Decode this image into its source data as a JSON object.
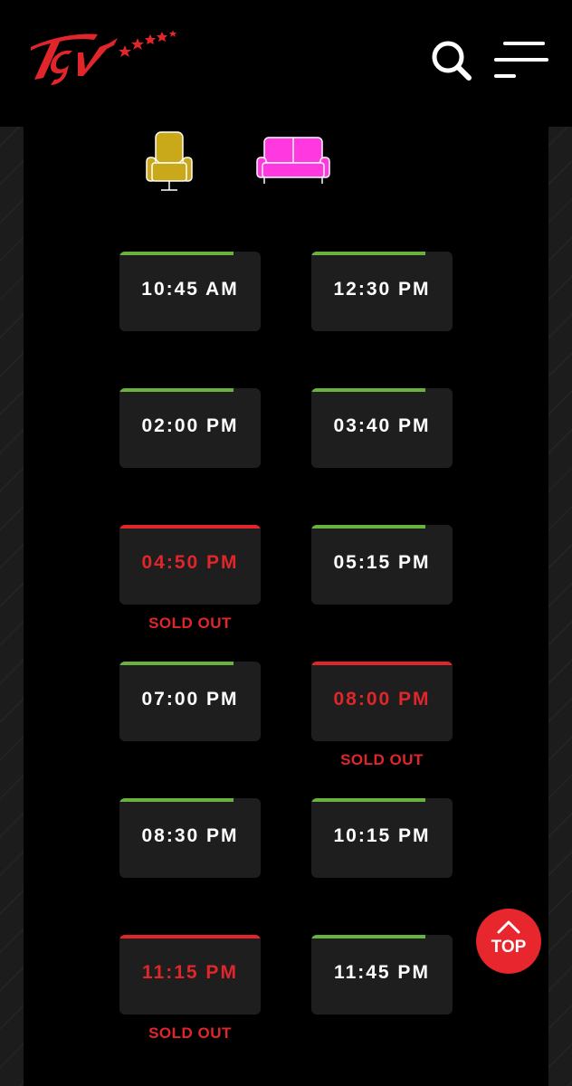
{
  "header": {
    "logo_text": "Tgv",
    "search_icon": "search-icon",
    "menu_icon": "hamburger-menu-icon"
  },
  "colors": {
    "accent_red": "#e0262b",
    "available_green": "#6ab23e",
    "single_seat": "#c9a81a",
    "couple_seat": "#ff38e0"
  },
  "legend": {
    "single_seat_icon": "single-seat-icon",
    "couple_seat_icon": "couple-seat-icon"
  },
  "showtimes": [
    {
      "time": "10:45 AM",
      "status": "available",
      "status_label": ""
    },
    {
      "time": "12:30 PM",
      "status": "available",
      "status_label": ""
    },
    {
      "time": "02:00 PM",
      "status": "available",
      "status_label": ""
    },
    {
      "time": "03:40 PM",
      "status": "available",
      "status_label": ""
    },
    {
      "time": "04:50 PM",
      "status": "soldout",
      "status_label": "SOLD OUT"
    },
    {
      "time": "05:15 PM",
      "status": "available",
      "status_label": ""
    },
    {
      "time": "07:00 PM",
      "status": "available",
      "status_label": ""
    },
    {
      "time": "08:00 PM",
      "status": "soldout",
      "status_label": "SOLD OUT"
    },
    {
      "time": "08:30 PM",
      "status": "available",
      "status_label": ""
    },
    {
      "time": "10:15 PM",
      "status": "available",
      "status_label": ""
    },
    {
      "time": "11:15 PM",
      "status": "soldout",
      "status_label": "SOLD OUT"
    },
    {
      "time": "11:45 PM",
      "status": "available",
      "status_label": ""
    }
  ],
  "top_button": {
    "label": "TOP",
    "icon": "chevron-up-icon"
  }
}
